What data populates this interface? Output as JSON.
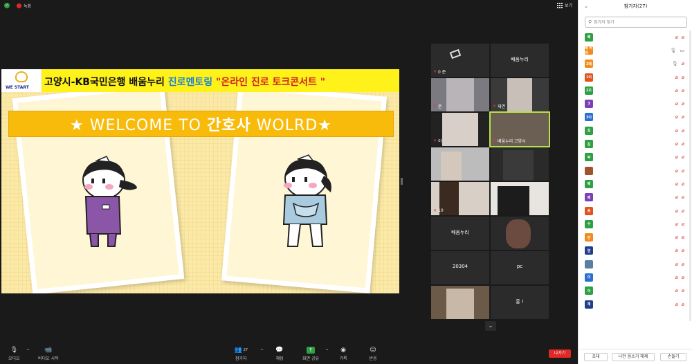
{
  "topbar": {
    "rec_label": "녹화",
    "view_label": "보기"
  },
  "slide": {
    "logo_text": "WE START",
    "banner_part1": "고양시-KB국민은행 배움누리 ",
    "banner_part2": "진로멘토링 ",
    "banner_part3": "\"온라인 진로 토크콘서트 \"",
    "welcome_prefix": "★ WELCOME TO ",
    "welcome_kr": "간호사",
    "welcome_suffix": " WOLRD★"
  },
  "grid": {
    "tiles": [
      {
        "name": "0 준",
        "center": ""
      },
      {
        "name": "",
        "center": "배움누리"
      },
      {
        "name": "준",
        "center": ""
      },
      {
        "name": "재연",
        "center": ""
      },
      {
        "name": "이",
        "center": ""
      },
      {
        "name": "배움누리 고양시",
        "center": ""
      },
      {
        "name": "",
        "center": ""
      },
      {
        "name": "재",
        "center": ""
      },
      {
        "name": "10",
        "center": ""
      },
      {
        "name": "",
        "center": ""
      },
      {
        "name": "",
        "center": "배움누리"
      },
      {
        "name": "",
        "center": ""
      },
      {
        "name": "",
        "center": "20304"
      },
      {
        "name": "",
        "center": "pc"
      },
      {
        "name": "",
        "center": ""
      },
      {
        "name": "",
        "center": "홍 !"
      }
    ],
    "down_icon": "chevron-down"
  },
  "toolbar": {
    "audio": "오디오",
    "video": "비디오 시작",
    "participants": "참가자",
    "participants_count": "27",
    "chat": "채팅",
    "share": "화면 공유",
    "record": "기록",
    "reactions": "반응",
    "leave": "나가기"
  },
  "panel": {
    "title": "참가자(27)",
    "search_placeholder": "참가자 찾기",
    "participants": [
      {
        "avatar": "배",
        "color": "#2ea043",
        "name": "",
        "mic": false,
        "cam": false
      },
      {
        "avatar": "배 허마",
        "color": "#f08c1c",
        "name": "",
        "mic": true,
        "cam": true
      },
      {
        "avatar": "2매",
        "color": "#f08c1c",
        "name": "",
        "mic": true,
        "cam": false
      },
      {
        "avatar": "1이",
        "color": "#e0531f",
        "name": "",
        "mic": false,
        "cam": false
      },
      {
        "avatar": "2조",
        "color": "#2ea043",
        "name": "",
        "mic": false,
        "cam": false
      },
      {
        "avatar": "3",
        "color": "#7b3fb8",
        "name": "",
        "mic": false,
        "cam": false
      },
      {
        "avatar": "3이",
        "color": "#2b6fd0",
        "name": "",
        "mic": false,
        "cam": false
      },
      {
        "avatar": "김",
        "color": "#2ea043",
        "name": "",
        "mic": false,
        "cam": false
      },
      {
        "avatar": "김",
        "color": "#2ea043",
        "name": "",
        "mic": false,
        "cam": false
      },
      {
        "avatar": "박",
        "color": "#2ea043",
        "name": "",
        "mic": false,
        "cam": false
      },
      {
        "avatar": "",
        "color": "#a0522d",
        "name": "",
        "mic": false,
        "cam": false
      },
      {
        "avatar": "베",
        "color": "#2ea043",
        "name": "",
        "mic": false,
        "cam": false
      },
      {
        "avatar": "베",
        "color": "#7b3fb8",
        "name": "",
        "mic": false,
        "cam": false
      },
      {
        "avatar": "송",
        "color": "#e0531f",
        "name": "",
        "mic": false,
        "cam": false
      },
      {
        "avatar": "수",
        "color": "#2ea043",
        "name": "",
        "mic": false,
        "cam": false
      },
      {
        "avatar": "안",
        "color": "#f08c1c",
        "name": "",
        "mic": false,
        "cam": false
      },
      {
        "avatar": "염",
        "color": "#1f3f8a",
        "name": "",
        "mic": false,
        "cam": false
      },
      {
        "avatar": "",
        "color": "#5a7fa0",
        "name": "",
        "mic": false,
        "cam": false
      },
      {
        "avatar": "이",
        "color": "#2b6fd0",
        "name": "",
        "mic": false,
        "cam": false
      },
      {
        "avatar": "이",
        "color": "#2ea043",
        "name": "",
        "mic": false,
        "cam": false
      },
      {
        "avatar": "재",
        "color": "#1f3f8a",
        "name": "",
        "mic": false,
        "cam": false
      }
    ],
    "footer": {
      "invite": "초대",
      "mute_all": "나만 음소거 해제",
      "more": "손들기"
    }
  }
}
